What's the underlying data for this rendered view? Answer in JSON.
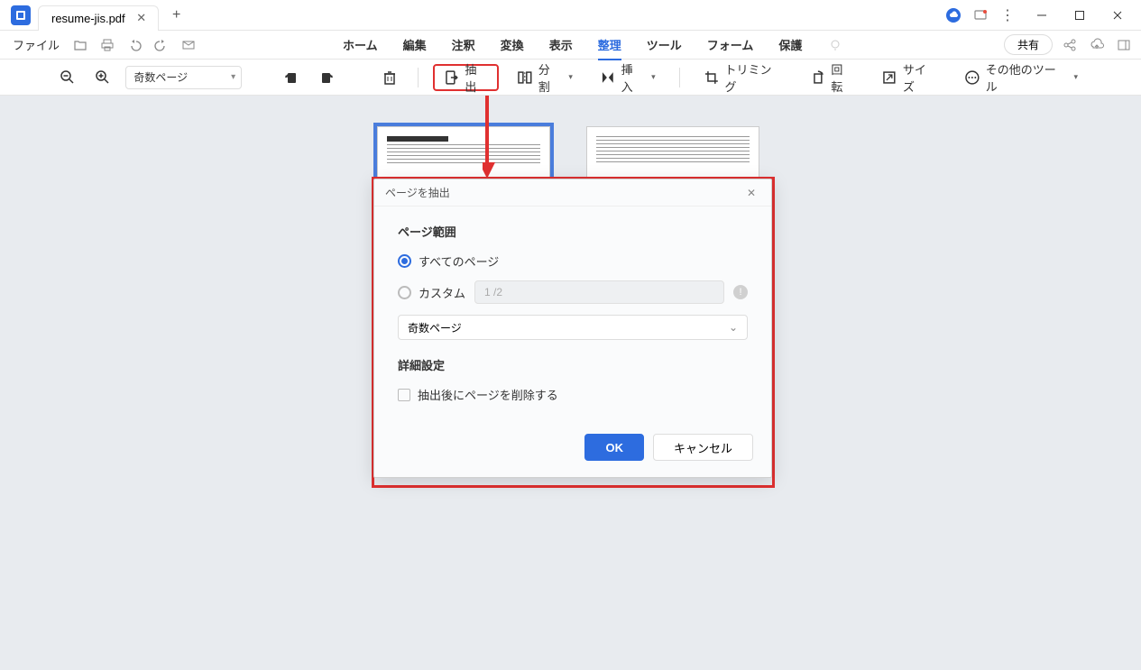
{
  "window": {
    "tab_title": "resume-jis.pdf"
  },
  "menu": {
    "file": "ファイル",
    "tabs": [
      "ホーム",
      "編集",
      "注釈",
      "変換",
      "表示",
      "整理",
      "ツール",
      "フォーム",
      "保護"
    ],
    "active_index": 5,
    "share": "共有"
  },
  "toolbar": {
    "zoom_mode": "奇数ページ",
    "extract": "抽出",
    "split": "分割",
    "insert": "挿入",
    "trimming": "トリミング",
    "rotate": "回転",
    "size": "サイズ",
    "other_tools": "その他のツール"
  },
  "dialog": {
    "title": "ページを抽出",
    "range_section": "ページ範囲",
    "all_pages": "すべてのページ",
    "custom": "カスタム",
    "range_placeholder": "1 /2",
    "dropdown_value": "奇数ページ",
    "advanced_section": "詳細設定",
    "delete_after": "抽出後にページを削除する",
    "ok": "OK",
    "cancel": "キャンセル"
  }
}
